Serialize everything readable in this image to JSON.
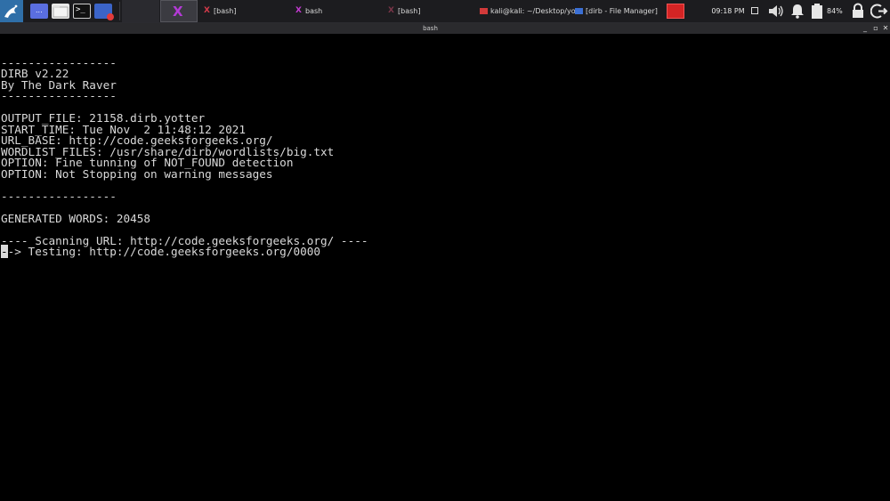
{
  "taskbar": {
    "workspace_launcher_label": "...",
    "terminal_launcher_glyph": ">_",
    "tasks": [
      {
        "label": "[bash]"
      },
      {
        "label": "bash"
      },
      {
        "label": "[bash]"
      },
      {
        "label": "kali@kali: ~/Desktop/yot..."
      },
      {
        "label": "[dirb - File Manager]"
      }
    ],
    "clock": "09:18 PM",
    "battery": "84%",
    "colors": {
      "accent": "#2f6fa8",
      "task_x": "#c23ad0",
      "red_app": "#d42424"
    }
  },
  "window": {
    "title": "bash",
    "controls": {
      "minimize": "_",
      "maximize": "▫",
      "close": "✕"
    }
  },
  "terminal": {
    "cursor_char": "-",
    "lines_before_cursor": [
      "",
      "-----------------",
      "DIRB v2.22",
      "By The Dark Raver",
      "-----------------",
      "",
      "OUTPUT_FILE: 21158.dirb.yotter",
      "START_TIME: Tue Nov  2 11:48:12 2021",
      "URL_BASE: http://code.geeksforgeeks.org/",
      "WORDLIST_FILES: /usr/share/dirb/wordlists/big.txt",
      "OPTION: Fine tunning of NOT_FOUND detection",
      "OPTION: Not Stopping on warning messages",
      "",
      "-----------------",
      "",
      "GENERATED WORDS: 20458",
      "",
      "---- Scanning URL: http://code.geeksforgeeks.org/ ----"
    ],
    "cursor_line_rest": "-> Testing: http://code.geeksforgeeks.org/0000"
  }
}
